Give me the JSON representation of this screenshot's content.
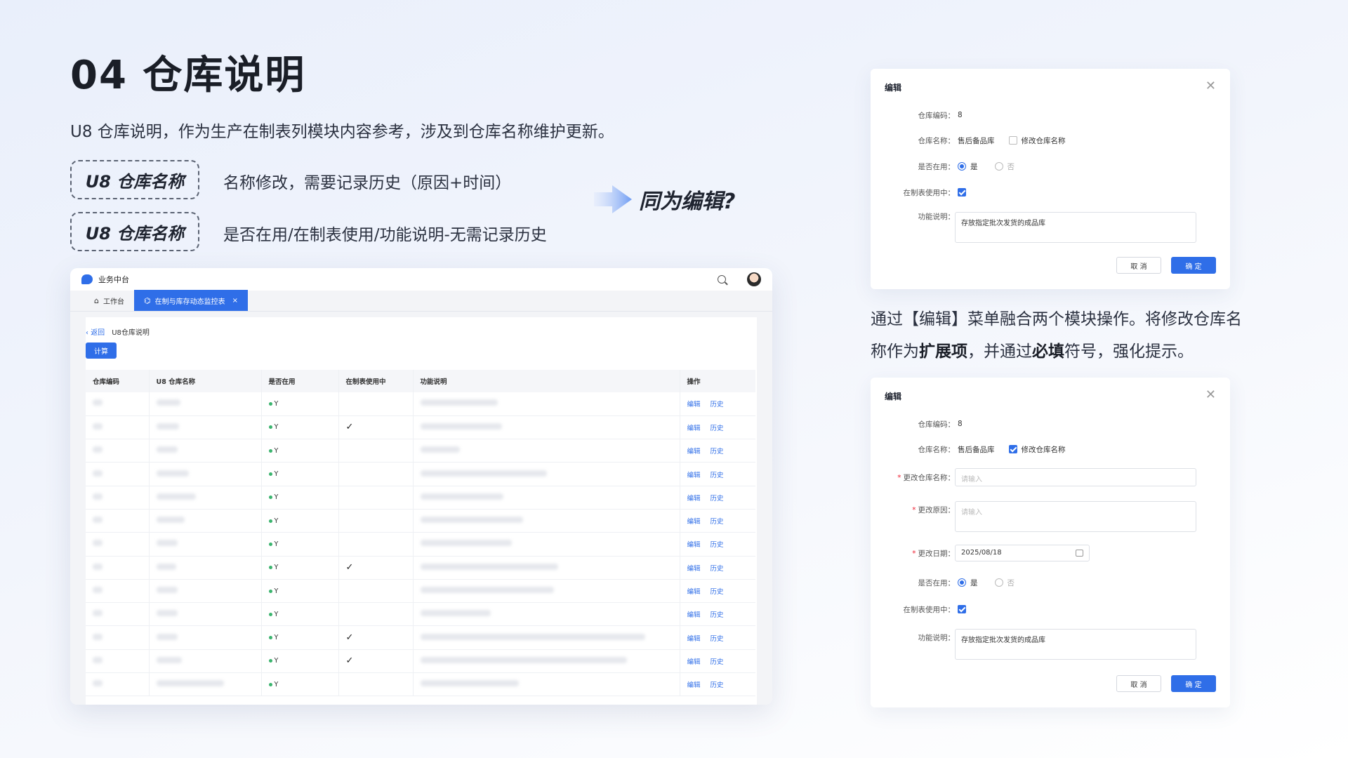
{
  "page": {
    "title": "04 仓库说明",
    "intro": "U8 仓库说明，作为生产在制表列模块内容参考，涉及到仓库名称维护更新。",
    "tags": [
      {
        "label": "U8 仓库名称",
        "desc": "名称修改，需要记录历史（原因+时间）"
      },
      {
        "label": "U8 仓库名称",
        "desc": "是否在用/在制表使用/功能说明-无需记录历史"
      }
    ],
    "same_edit": "同为编辑?",
    "description": {
      "p1": "通过【编辑】菜单融合两个模块操作。将修改仓库名称作为",
      "b1": "扩展项",
      "p2": "，并通过",
      "b2": "必填",
      "p3": "符号，强化提示。"
    }
  },
  "app": {
    "brand": "业务中台",
    "tabs": [
      {
        "label": "工作台"
      },
      {
        "label": "在制与库存动态监控表"
      }
    ],
    "breadcrumb": {
      "back": "返回",
      "current": "U8仓库说明"
    },
    "calc_button": "计算",
    "columns": [
      "仓库编码",
      "U8 仓库名称",
      "是否在用",
      "在制表使用中",
      "功能说明",
      "操作"
    ],
    "rows": [
      {
        "in_use": "Y",
        "checked": false
      },
      {
        "in_use": "Y",
        "checked": true
      },
      {
        "in_use": "Y",
        "checked": false
      },
      {
        "in_use": "Y",
        "checked": false
      },
      {
        "in_use": "Y",
        "checked": false
      },
      {
        "in_use": "Y",
        "checked": false
      },
      {
        "in_use": "Y",
        "checked": false
      },
      {
        "in_use": "Y",
        "checked": true
      },
      {
        "in_use": "Y",
        "checked": false
      },
      {
        "in_use": "Y",
        "checked": false
      },
      {
        "in_use": "Y",
        "checked": true
      },
      {
        "in_use": "Y",
        "checked": true
      },
      {
        "in_use": "Y",
        "checked": false
      }
    ],
    "ops": {
      "edit": "编辑",
      "history": "历史"
    }
  },
  "dialog1": {
    "title": "编辑",
    "code_label": "仓库编码：",
    "code_value": "8",
    "name_label": "仓库名称：",
    "name_value": "售后备品库",
    "modify_name": "修改仓库名称",
    "in_use_label": "是否在用：",
    "yes": "是",
    "no": "否",
    "in_table_label": "在制表使用中：",
    "func_label": "功能说明：",
    "func_value": "存放指定批次发货的成品库",
    "cancel": "取 消",
    "ok": "确 定"
  },
  "dialog2": {
    "title": "编辑",
    "code_label": "仓库编码：",
    "code_value": "8",
    "name_label": "仓库名称：",
    "name_value": "售后备品库",
    "modify_name": "修改仓库名称",
    "new_name_label": "更改仓库名称：",
    "new_name_placeholder": "请输入",
    "reason_label": "更改原因：",
    "reason_placeholder": "请输入",
    "date_label": "更改日期：",
    "date_value": "2025/08/18",
    "in_use_label": "是否在用：",
    "yes": "是",
    "no": "否",
    "in_table_label": "在制表使用中：",
    "func_label": "功能说明：",
    "func_value": "存放指定批次发货的成品库",
    "cancel": "取 消",
    "ok": "确 定"
  },
  "colors": {
    "accent": "#2f6ee8",
    "required": "#e23333",
    "status_dot": "#3bb46e"
  }
}
